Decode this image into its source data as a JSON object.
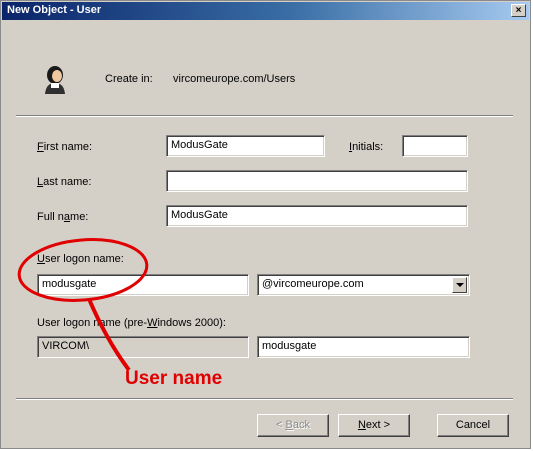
{
  "window": {
    "title": "New Object - User",
    "close_glyph": "×"
  },
  "header": {
    "create_in_label": "Create in:",
    "create_in_value": "vircomeurope.com/Users",
    "icon": "user-icon"
  },
  "form": {
    "first_name": {
      "accel": "F",
      "label_rest": "irst name:",
      "value": "ModusGate"
    },
    "initials": {
      "accel": "I",
      "label_rest": "nitials:",
      "value": ""
    },
    "last_name": {
      "accel": "L",
      "label_rest": "ast name:",
      "value": ""
    },
    "full_name": {
      "label_pre": "Full n",
      "accel": "a",
      "label_rest": "me:",
      "value": "ModusGate"
    },
    "logon_name": {
      "accel": "U",
      "label_rest": "ser logon name:",
      "value": "modusgate",
      "domain": "@vircomeurope.com"
    },
    "pre2000": {
      "label_pre": "User logon name (pre-",
      "accel": "W",
      "label_rest": "indows 2000):",
      "domain": "VIRCOM\\",
      "value": "modusgate"
    }
  },
  "buttons": {
    "back": {
      "pre": "< ",
      "accel": "B",
      "rest": "ack"
    },
    "next": {
      "pre": "",
      "accel": "N",
      "rest": "ext >"
    },
    "cancel": "Cancel"
  },
  "annotation": {
    "text": "User name",
    "color": "#e00000"
  }
}
